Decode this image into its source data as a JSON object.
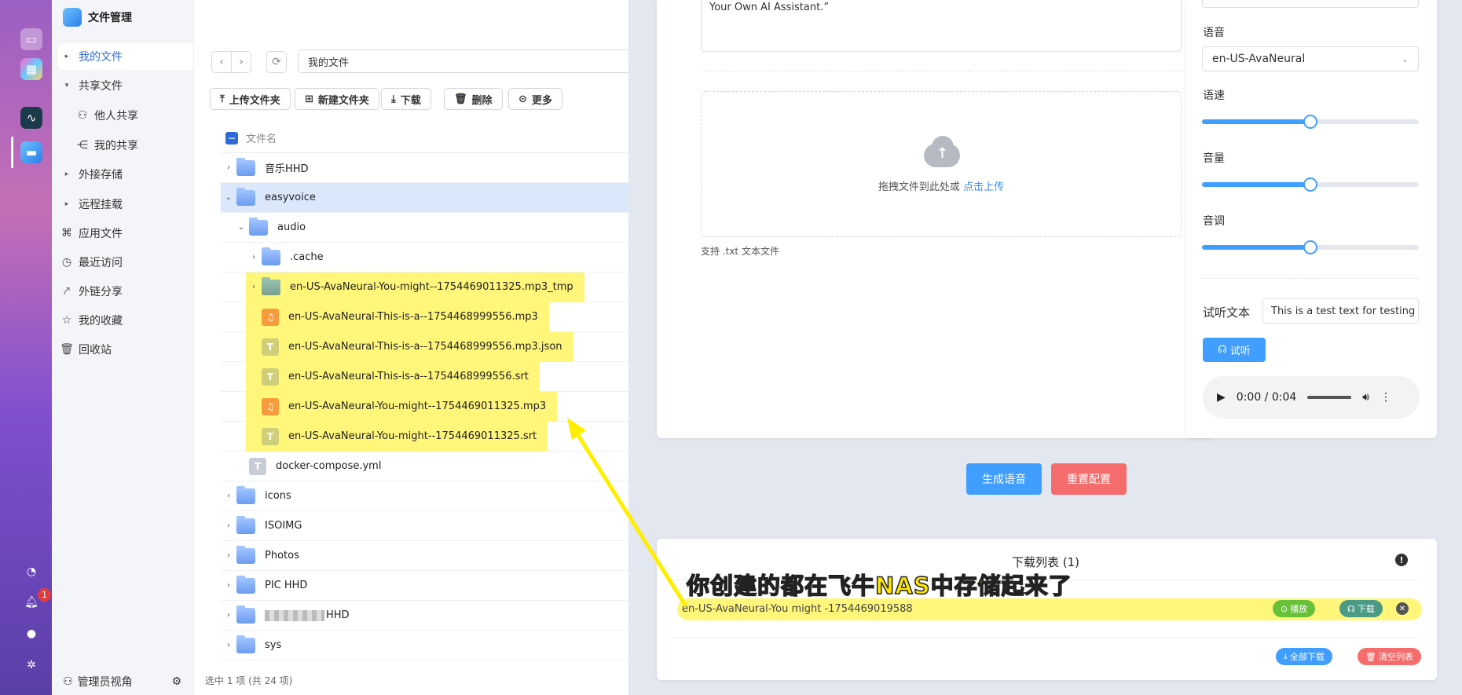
{
  "dock": {
    "badge_count": "1"
  },
  "fm": {
    "title": "文件管理",
    "nav": [
      {
        "label": "我的文件",
        "icon": "caret-right",
        "active": true
      },
      {
        "label": "共享文件",
        "icon": "caret-down"
      },
      {
        "label": "他人共享",
        "icon": "user-icon",
        "sub": true
      },
      {
        "label": "我的共享",
        "icon": "share-icon",
        "sub": true
      },
      {
        "label": "外接存储",
        "icon": "caret-right"
      },
      {
        "label": "远程挂载",
        "icon": "caret-right"
      },
      {
        "label": "应用文件",
        "icon": "apps-icon"
      },
      {
        "label": "最近访问",
        "icon": "clock-icon"
      },
      {
        "label": "外链分享",
        "icon": "link-icon"
      },
      {
        "label": "我的收藏",
        "icon": "star-icon"
      },
      {
        "label": "回收站",
        "icon": "trash-icon"
      }
    ],
    "footer_label": "管理员视角",
    "path": "我的文件",
    "toolbar": {
      "upload": "上传文件夹",
      "new_folder": "新建文件夹",
      "download": "下载",
      "delete": "删除",
      "more": "更多"
    },
    "col_name": "文件名",
    "rows": [
      {
        "name": "音乐HHD",
        "type": "folder",
        "level": 0,
        "caret": "›"
      },
      {
        "name": "easyvoice",
        "type": "folder",
        "level": 0,
        "caret": "⌄",
        "selected": true
      },
      {
        "name": "audio",
        "type": "folder",
        "level": 1,
        "caret": "⌄"
      },
      {
        "name": ".cache",
        "type": "folder",
        "level": 2,
        "caret": "›"
      },
      {
        "name": "en-US-AvaNeural-You-might--1754469011325.mp3_tmp",
        "type": "tmp",
        "level": 2,
        "caret": "›",
        "hl": true
      },
      {
        "name": "en-US-AvaNeural-This-is-a--1754468999556.mp3",
        "type": "mp3",
        "level": 2,
        "hl": true
      },
      {
        "name": "en-US-AvaNeural-This-is-a--1754468999556.mp3.json",
        "type": "txt",
        "level": 2,
        "hl": true
      },
      {
        "name": "en-US-AvaNeural-This-is-a--1754468999556.srt",
        "type": "txt",
        "level": 2,
        "hl": true
      },
      {
        "name": "en-US-AvaNeural-You-might--1754469011325.mp3",
        "type": "mp3",
        "level": 2,
        "hl": true
      },
      {
        "name": "en-US-AvaNeural-You-might--1754469011325.srt",
        "type": "txt",
        "level": 2,
        "hl": true
      },
      {
        "name": "docker-compose.yml",
        "type": "yml",
        "level": 1
      },
      {
        "name": "icons",
        "type": "folder",
        "level": 0,
        "caret": "›"
      },
      {
        "name": "ISOIMG",
        "type": "folder",
        "level": 0,
        "caret": "›"
      },
      {
        "name": "Photos",
        "type": "folder",
        "level": 0,
        "caret": "›"
      },
      {
        "name": "PIC HHD",
        "type": "folder",
        "level": 0,
        "caret": "›"
      },
      {
        "name": "HHD",
        "type": "folder",
        "level": 0,
        "caret": "›",
        "blurred": true
      },
      {
        "name": "sys",
        "type": "folder",
        "level": 0,
        "caret": "›"
      }
    ],
    "status": "选中 1 项 (共 24 项)"
  },
  "app": {
    "text_value": "Your Own AI Assistant.”",
    "drop_text": "拖拽文件到此处或",
    "drop_link": "点击上传",
    "support": "支持 .txt 文本文件",
    "voice_label": "语音",
    "voice_value": "en-US-AvaNeural",
    "rate_label": "语速",
    "volume_label": "音量",
    "pitch_label": "音调",
    "rate_level": 0.5,
    "volume_level": 0.5,
    "pitch_level": 0.5,
    "preview_label": "试听文本",
    "preview_value": "This is a test text for testing t",
    "preview_btn": "试听",
    "audio_time": "0:00 / 0:04",
    "generate_btn": "生成语音",
    "reset_btn": "重置配置",
    "dl_title": "下载列表 (1)",
    "dl_item": "en-US-AvaNeural-You might -1754469019588",
    "play_btn": "播放",
    "download_btn": "下载",
    "download_all": "全部下载",
    "clear_list": "清空列表"
  },
  "annotation": {
    "caption": "你创建的都在飞牛NAS中存储起来了",
    "color": "#ffee00"
  }
}
